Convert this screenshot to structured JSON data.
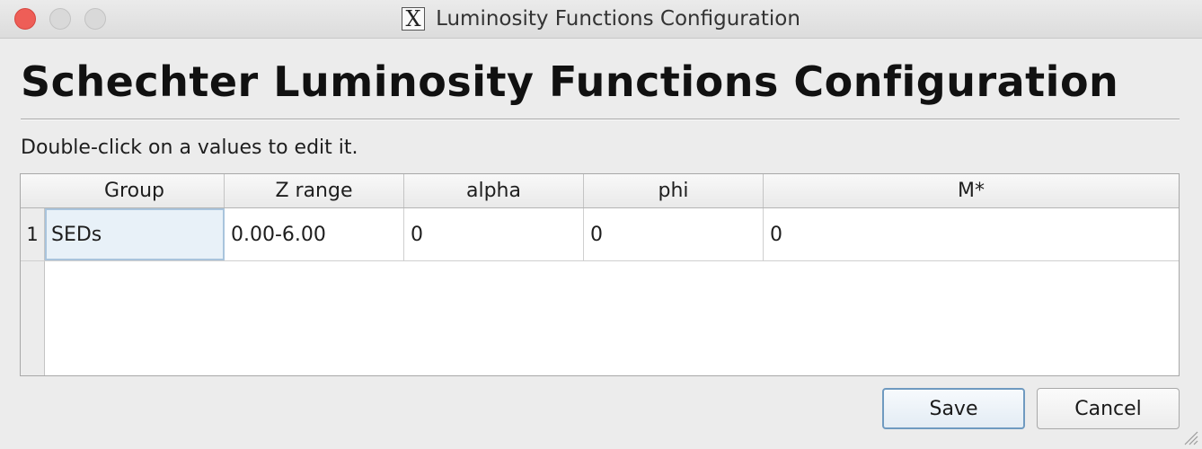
{
  "window": {
    "title": "Luminosity Functions Configuration"
  },
  "page": {
    "heading": "Schechter Luminosity Functions Configuration",
    "instructions": "Double-click on a values to edit it."
  },
  "table": {
    "columns": [
      "Group",
      "Z range",
      "alpha",
      "phi",
      "M*"
    ],
    "rows": [
      {
        "num": "1",
        "group": "SEDs",
        "z_range": "0.00-6.00",
        "alpha": "0",
        "phi": "0",
        "m_star": "0"
      }
    ]
  },
  "buttons": {
    "save": "Save",
    "cancel": "Cancel"
  },
  "icons": {
    "app": "x11-icon",
    "close": "close-icon",
    "minimize": "minimize-icon",
    "maximize": "maximize-icon",
    "resize": "resize-grip-icon"
  },
  "colors": {
    "close": "#ee5e57",
    "selection": "#e8f1f8",
    "default_button_border": "#6f9ac0"
  }
}
